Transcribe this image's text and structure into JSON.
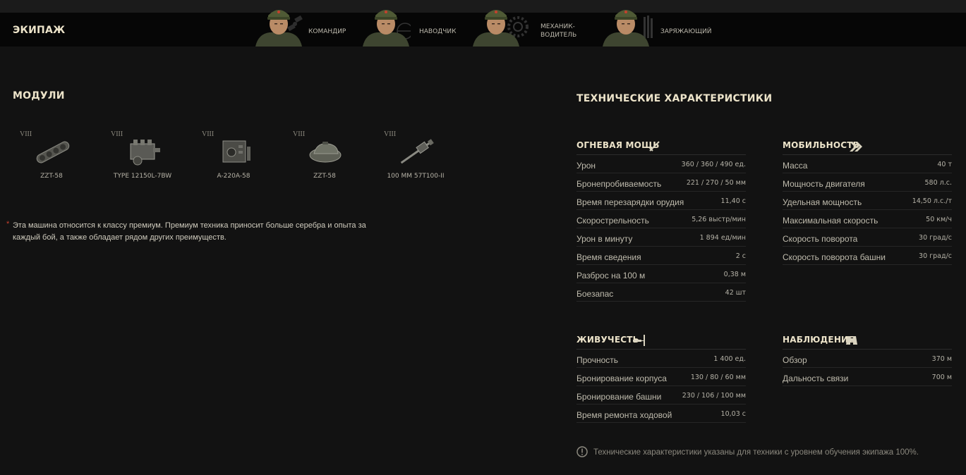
{
  "crew": {
    "title": "ЭКИПАЖ",
    "members": [
      {
        "role": "КОМАНДИР",
        "icon": "satellite-icon"
      },
      {
        "role": "НАВОДЧИК",
        "icon": "crosshair-icon"
      },
      {
        "role": "МЕХАНИК-\nВОДИТЕЛЬ",
        "icon": "gear-icon"
      },
      {
        "role": "ЗАРЯЖАЮЩИЙ",
        "icon": "shells-icon"
      }
    ]
  },
  "modules": {
    "title": "МОДУЛИ",
    "items": [
      {
        "tier": "VIII",
        "name": "ZZT-58",
        "icon": "tracks-icon"
      },
      {
        "tier": "VIII",
        "name": "TYPE 12150L-7BW",
        "icon": "engine-icon"
      },
      {
        "tier": "VIII",
        "name": "A-220A-58",
        "icon": "radio-icon"
      },
      {
        "tier": "VIII",
        "name": "ZZT-58",
        "icon": "turret-icon"
      },
      {
        "tier": "VIII",
        "name": "100 MM 57T100-II",
        "icon": "gun-icon"
      }
    ]
  },
  "premium_note": {
    "star": "*",
    "text": "Эта машина относится к классу премиум. Премиум техника приносит больше серебра и опыта за каждый бой, а также обладает рядом других преимуществ."
  },
  "specs": {
    "title": "ТЕХНИЧЕСКИЕ ХАРАКТЕРИСТИКИ",
    "firepower": {
      "name": "ОГНЕВАЯ МОЩЬ",
      "icon": "sword-icon",
      "rows": [
        {
          "label": "Урон",
          "value": "360 / 360 / 490 ед."
        },
        {
          "label": "Бронепробиваемость",
          "value": "221 / 270 / 50 мм"
        },
        {
          "label": "Время перезарядки орудия",
          "value": "11,40 с"
        },
        {
          "label": "Скорострельность",
          "value": "5,26 выстр/мин"
        },
        {
          "label": "Урон в минуту",
          "value": "1 894 ед/мин"
        },
        {
          "label": "Время сведения",
          "value": "2 с"
        },
        {
          "label": "Разброс на 100 м",
          "value": "0,38 м"
        },
        {
          "label": "Боезапас",
          "value": "42 шт"
        }
      ]
    },
    "survivability": {
      "name": "ЖИВУЧЕСТЬ",
      "icon": "armor-hit-icon",
      "rows": [
        {
          "label": "Прочность",
          "value": "1 400 ед."
        },
        {
          "label": "Бронирование корпуса",
          "value": "130 / 80 / 60 мм"
        },
        {
          "label": "Бронирование башни",
          "value": "230 / 106 / 100 мм"
        },
        {
          "label": "Время ремонта ходовой",
          "value": "10,03 с"
        }
      ]
    },
    "mobility": {
      "name": "МОБИЛЬНОСТЬ",
      "icon": "double-chevron-icon",
      "rows": [
        {
          "label": "Масса",
          "value": "40 т"
        },
        {
          "label": "Мощность двигателя",
          "value": "580 л.с."
        },
        {
          "label": "Удельная мощность",
          "value": "14,50 л.с./т"
        },
        {
          "label": "Максимальная скорость",
          "value": "50 км/ч"
        },
        {
          "label": "Скорость поворота",
          "value": "30 град/с"
        },
        {
          "label": "Скорость поворота башни",
          "value": "30 град/с"
        }
      ]
    },
    "observation": {
      "name": "НАБЛЮДЕНИЕ",
      "icon": "binoculars-icon",
      "rows": [
        {
          "label": "Обзор",
          "value": "370 м"
        },
        {
          "label": "Дальность связи",
          "value": "700 м"
        }
      ]
    },
    "footnote": "Технические характеристики указаны для техники с уровнем обучения экипажа 100%."
  },
  "colors": {
    "accent": "#ece3c9",
    "background": "#121212",
    "star": "#c8402d"
  }
}
